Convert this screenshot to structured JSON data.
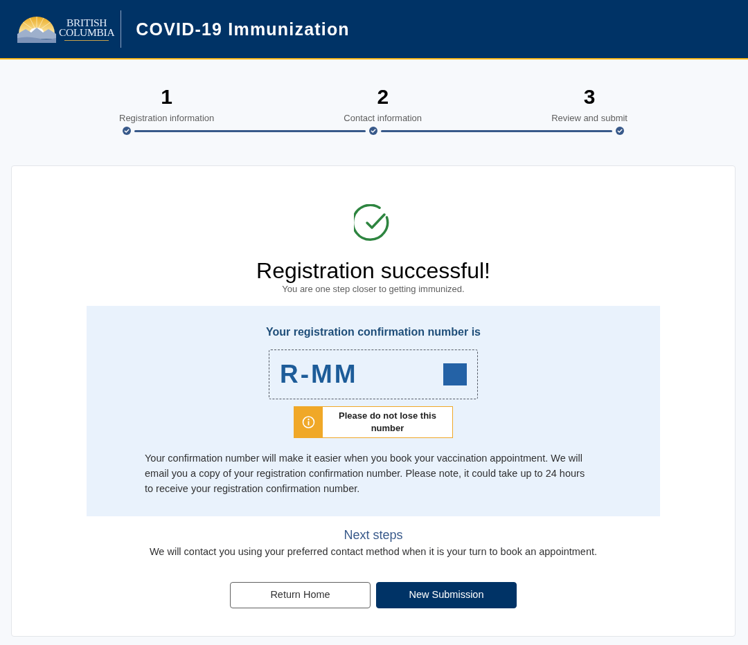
{
  "header": {
    "logo_lines": [
      "BRITISH",
      "COLUMBIA"
    ],
    "title": "COVID-19 Immunization"
  },
  "stepper": {
    "steps": [
      {
        "number": "1",
        "label": "Registration information",
        "completed": true
      },
      {
        "number": "2",
        "label": "Contact information",
        "completed": true
      },
      {
        "number": "3",
        "label": "Review and submit",
        "completed": true
      }
    ]
  },
  "result": {
    "title": "Registration successful!",
    "subtitle": "You are one step closer to getting immunized.",
    "panel": {
      "heading": "Your registration confirmation number is",
      "number": "R-MM",
      "redacted": true,
      "warning": "Please do not lose this number",
      "note": "Your confirmation number will make it easier when you book your vaccination appointment. We will email you a copy of your registration confirmation number. Please note, it could take up to 24 hours to receive your registration confirmation number."
    }
  },
  "next_steps": {
    "heading": "Next steps",
    "text": "We will contact you using your preferred contact method when it is your turn to book an appointment."
  },
  "buttons": [
    {
      "label": "Return Home",
      "kind": "secondary"
    },
    {
      "label": "New Submission",
      "kind": "primary"
    }
  ]
}
